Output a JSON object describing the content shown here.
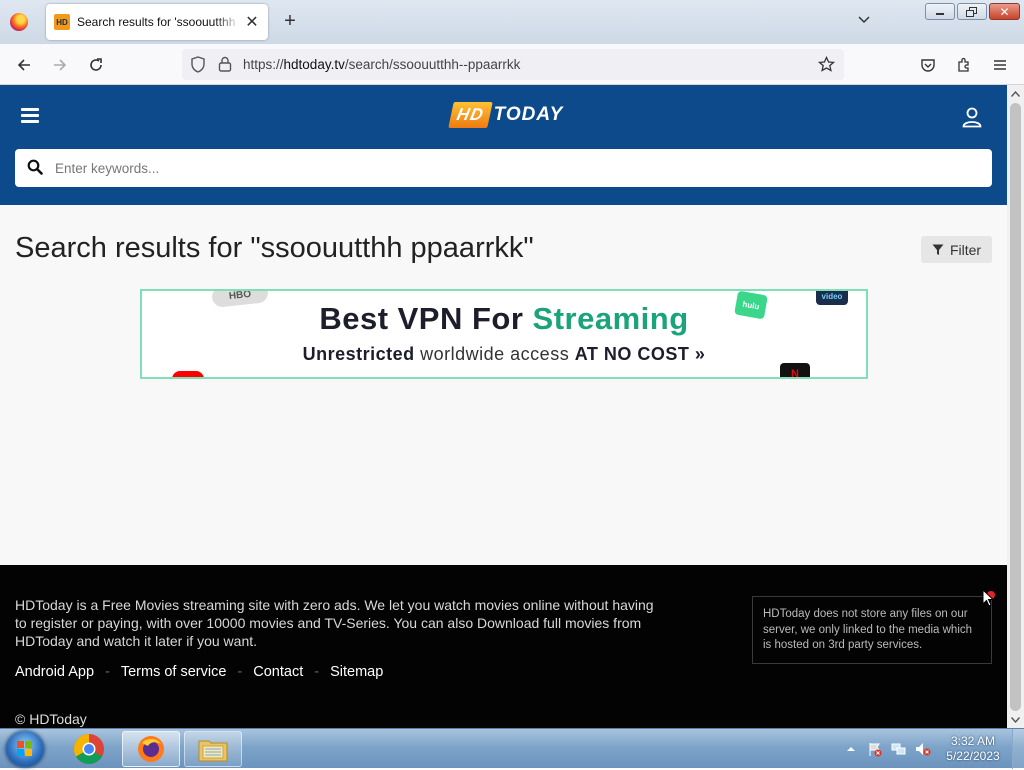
{
  "browser": {
    "tab_title": "Search results for 'ssoouutthh ppaarrkk' - HDToday",
    "tab_favicon_text": "HD",
    "new_tab_symbol": "+",
    "close_tab_symbol": "✕",
    "url_prefix": "https://",
    "url_host": "hdtoday.tv",
    "url_path": "/search/ssoouutthh--ppaarrkk",
    "window_close_symbol": "✕"
  },
  "site": {
    "logo_hd": "HD",
    "logo_today": "TODAY",
    "search_placeholder": "Enter keywords...",
    "search_value": "",
    "brand_color": "#0d4a8c"
  },
  "main": {
    "title": "Search results for \"ssoouutthh ppaarrkk\"",
    "filter_label": "Filter"
  },
  "ad_banner": {
    "headline_start": "Best VPN For ",
    "headline_accent": "Streaming",
    "sub_lead": "Unrestricted",
    "sub_mid": " worldwide access ",
    "sub_bold": "AT NO COST »",
    "accent_color": "#1ba37a",
    "logos": [
      "HBO",
      "hulu",
      "video",
      "N"
    ]
  },
  "footer": {
    "about": "HDToday is a Free Movies streaming site with zero ads. We let you watch movies online without having to register or paying, with over 10000 movies and TV-Series. You can also Download full movies from HDToday and watch it later if you want.",
    "links": [
      "Android App",
      "Terms of service",
      "Contact",
      "Sitemap"
    ],
    "separator": "-",
    "copyright": "© HDToday",
    "disclaimer": "HDToday does not store any files on our server, we only linked to the media which is hosted on 3rd party services."
  },
  "taskbar": {
    "time": "3:32 AM",
    "date": "5/22/2023",
    "apps": [
      "chrome",
      "firefox",
      "explorer"
    ]
  }
}
